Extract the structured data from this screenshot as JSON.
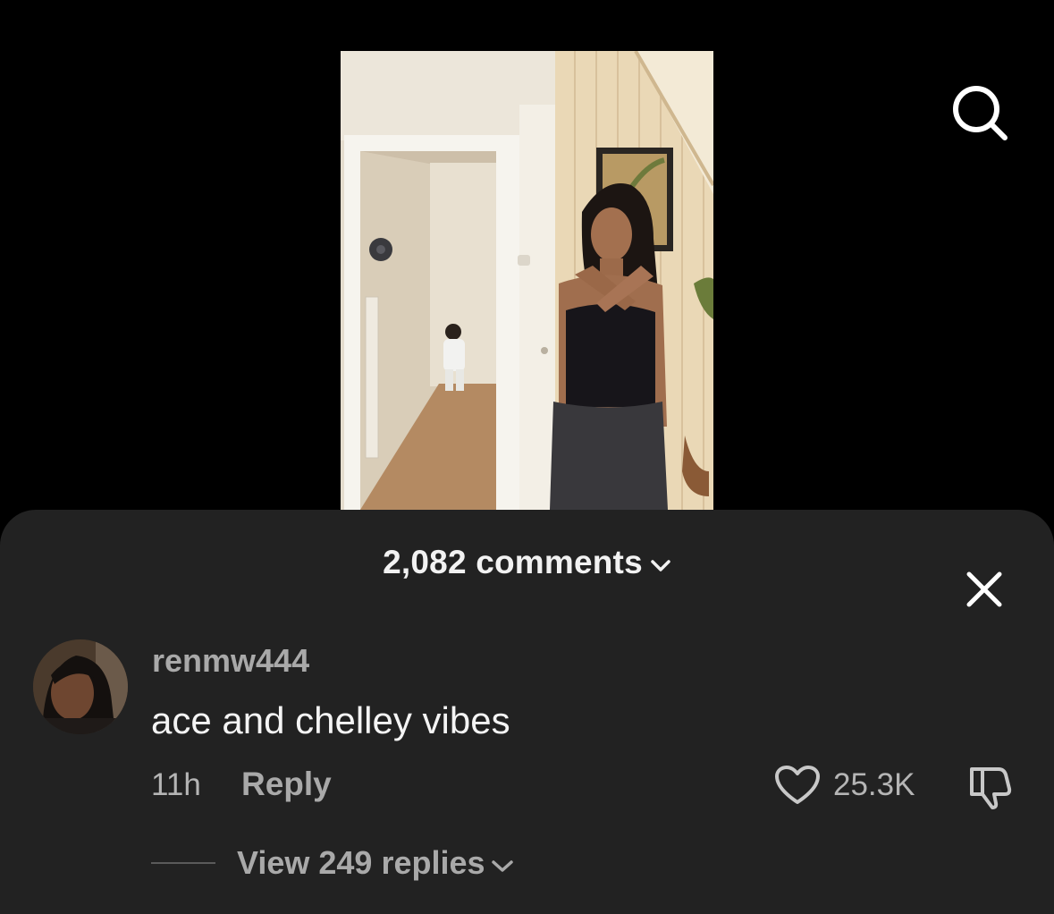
{
  "video": {
    "scene": "video-frame"
  },
  "top_actions": {
    "search_icon": "search-icon"
  },
  "comments_sheet": {
    "count_label": "2,082 comments",
    "expand_icon": "chevron-down-icon",
    "close_icon": "close-icon"
  },
  "comments": [
    {
      "username": "renmw444",
      "text": "ace and chelley vibes",
      "time": "11h",
      "reply_label": "Reply",
      "likes": "25.3K",
      "like_icon": "heart-icon",
      "dislike_icon": "thumbs-down-icon",
      "view_replies_label": "View 249 replies"
    }
  ],
  "colors": {
    "sheet_background": "#222222",
    "primary_text": "#f4f4f4",
    "secondary_text": "#a9a9a9"
  }
}
